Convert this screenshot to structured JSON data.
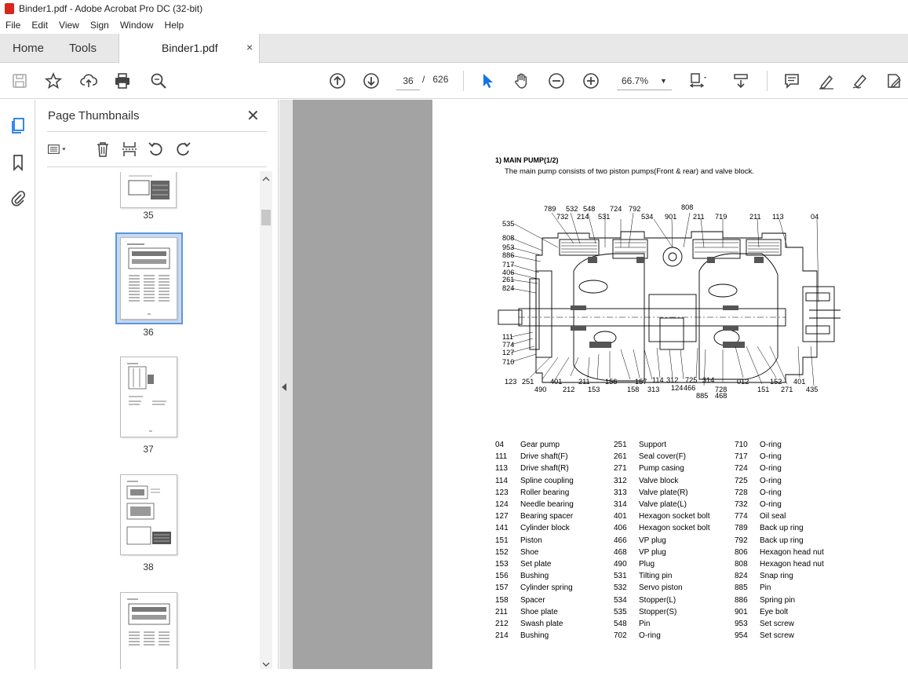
{
  "window": {
    "title": "Binder1.pdf - Adobe Acrobat Pro DC (32-bit)"
  },
  "menu": [
    "File",
    "Edit",
    "View",
    "Sign",
    "Window",
    "Help"
  ],
  "tabs": {
    "home": "Home",
    "tools": "Tools",
    "document": "Binder1.pdf",
    "close": "×"
  },
  "toolbar": {
    "page_current": "36",
    "page_sep": "/",
    "page_total": "626",
    "zoom": "66.7%"
  },
  "sidebar": {
    "title": "Page Thumbnails",
    "close": "✕",
    "thumbnails": [
      {
        "label": "35"
      },
      {
        "label": "36"
      },
      {
        "label": "37"
      },
      {
        "label": "38"
      }
    ]
  },
  "page": {
    "section_title": "1)  MAIN PUMP(1/2)",
    "description": "The main pump consists of two piston pumps(Front & rear) and valve block.",
    "callouts": [
      "789",
      "732",
      "532",
      "548",
      "214",
      "531",
      "724",
      "792",
      "534",
      "808",
      "901",
      "211",
      "719",
      "211",
      "113",
      "04",
      "535",
      "808",
      "953",
      "886",
      "717",
      "406",
      "261",
      "824",
      "111",
      "774",
      "127",
      "710",
      "123",
      "251",
      "490",
      "401",
      "212",
      "211",
      "153",
      "156",
      "158",
      "157",
      "313",
      "114",
      "312",
      "124",
      "466",
      "725",
      "885",
      "314",
      "728",
      "468",
      "012",
      "151",
      "152",
      "271",
      "401",
      "435"
    ],
    "legend": [
      [
        {
          "num": "04",
          "label": "Gear pump"
        },
        {
          "num": "111",
          "label": "Drive shaft(F)"
        },
        {
          "num": "113",
          "label": "Drive shaft(R)"
        },
        {
          "num": "114",
          "label": "Spline coupling"
        },
        {
          "num": "123",
          "label": "Roller bearing"
        },
        {
          "num": "124",
          "label": "Needle bearing"
        },
        {
          "num": "127",
          "label": "Bearing spacer"
        },
        {
          "num": "141",
          "label": "Cylinder block"
        },
        {
          "num": "151",
          "label": "Piston"
        },
        {
          "num": "152",
          "label": "Shoe"
        },
        {
          "num": "153",
          "label": "Set plate"
        },
        {
          "num": "156",
          "label": "Bushing"
        },
        {
          "num": "157",
          "label": "Cylinder spring"
        },
        {
          "num": "158",
          "label": "Spacer"
        },
        {
          "num": "211",
          "label": "Shoe plate"
        },
        {
          "num": "212",
          "label": "Swash plate"
        },
        {
          "num": "214",
          "label": "Bushing"
        }
      ],
      [
        {
          "num": "251",
          "label": "Support"
        },
        {
          "num": "261",
          "label": "Seal cover(F)"
        },
        {
          "num": "271",
          "label": "Pump casing"
        },
        {
          "num": "312",
          "label": "Valve block"
        },
        {
          "num": "313",
          "label": "Valve plate(R)"
        },
        {
          "num": "314",
          "label": "Valve plate(L)"
        },
        {
          "num": "401",
          "label": "Hexagon socket bolt"
        },
        {
          "num": "406",
          "label": "Hexagon socket bolt"
        },
        {
          "num": "466",
          "label": "VP plug"
        },
        {
          "num": "468",
          "label": "VP plug"
        },
        {
          "num": "490",
          "label": "Plug"
        },
        {
          "num": "531",
          "label": "Tilting pin"
        },
        {
          "num": "532",
          "label": "Servo piston"
        },
        {
          "num": "534",
          "label": "Stopper(L)"
        },
        {
          "num": "535",
          "label": "Stopper(S)"
        },
        {
          "num": "548",
          "label": "Pin"
        },
        {
          "num": "702",
          "label": "O-ring"
        }
      ],
      [
        {
          "num": "710",
          "label": "O-ring"
        },
        {
          "num": "717",
          "label": "O-ring"
        },
        {
          "num": "724",
          "label": "O-ring"
        },
        {
          "num": "725",
          "label": "O-ring"
        },
        {
          "num": "728",
          "label": "O-ring"
        },
        {
          "num": "732",
          "label": "O-ring"
        },
        {
          "num": "774",
          "label": "Oil seal"
        },
        {
          "num": "789",
          "label": "Back up ring"
        },
        {
          "num": "792",
          "label": "Back up ring"
        },
        {
          "num": "806",
          "label": "Hexagon head nut"
        },
        {
          "num": "808",
          "label": "Hexagon head nut"
        },
        {
          "num": "824",
          "label": "Snap ring"
        },
        {
          "num": "885",
          "label": "Pin"
        },
        {
          "num": "886",
          "label": "Spring pin"
        },
        {
          "num": "901",
          "label": "Eye bolt"
        },
        {
          "num": "953",
          "label": "Set screw"
        },
        {
          "num": "954",
          "label": "Set screw"
        }
      ]
    ]
  }
}
